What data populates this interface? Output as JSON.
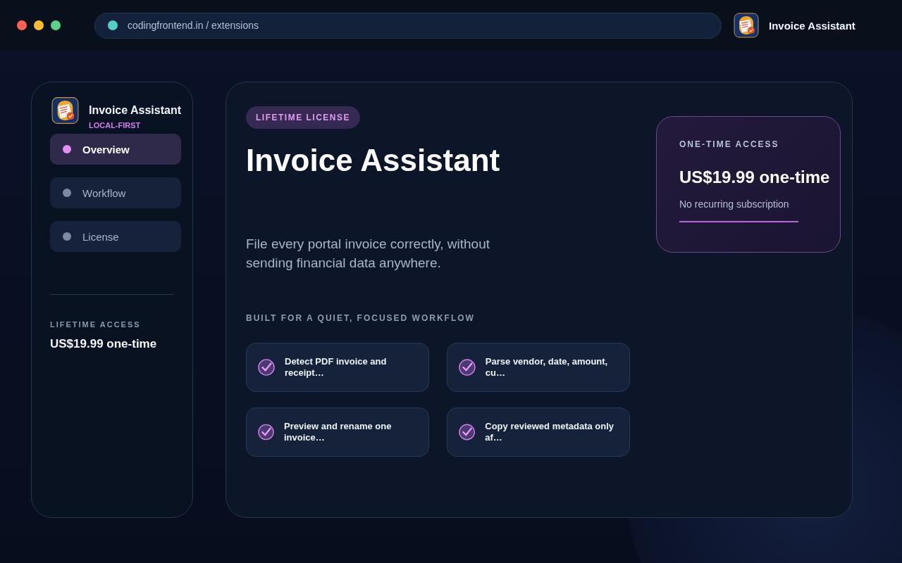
{
  "browser": {
    "address": "codingfrontend.in / extensions",
    "app_title": "Invoice Assistant"
  },
  "sidebar": {
    "title": "Invoice Assistant",
    "tagline": "LOCAL-FIRST",
    "items": [
      {
        "label": "Overview",
        "selected": true
      },
      {
        "label": "Workflow",
        "selected": false
      },
      {
        "label": "License",
        "selected": false
      }
    ],
    "access_label": "LIFETIME ACCESS",
    "access_price": "US$19.99 one-time"
  },
  "main": {
    "badge": "LIFETIME LICENSE",
    "title": "Invoice Assistant",
    "description": "File every portal invoice correctly, without sending financial data anywhere.",
    "section_label": "BUILT FOR A QUIET, FOCUSED WORKFLOW",
    "features": [
      "Detect PDF invoice and receipt…",
      "Parse vendor, date, amount, cu…",
      "Preview and rename one invoice…",
      "Copy reviewed metadata only af…"
    ]
  },
  "price_card": {
    "label": "ONE-TIME ACCESS",
    "price": "US$19.99 one-time",
    "note": "No recurring subscription"
  }
}
